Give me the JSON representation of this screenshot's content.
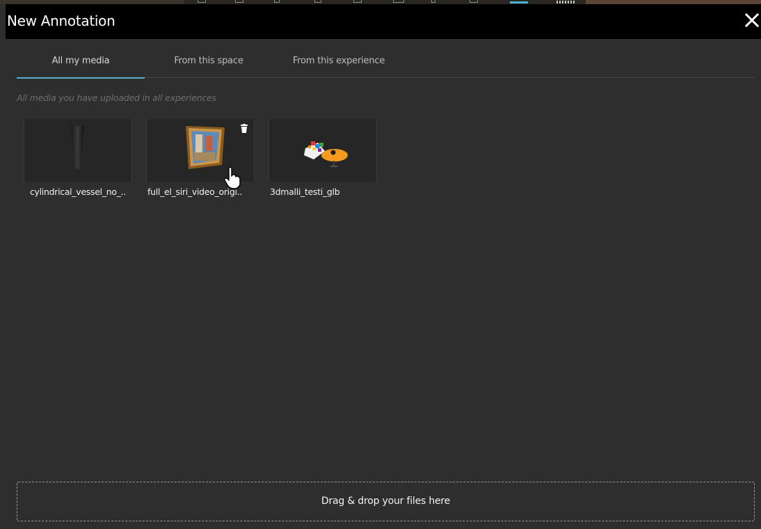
{
  "dialog": {
    "title": "New Annotation",
    "close_icon": "close-icon"
  },
  "tabs": [
    {
      "label": "All my media",
      "active": true
    },
    {
      "label": "From this space",
      "active": false
    },
    {
      "label": "From this experience",
      "active": false
    }
  ],
  "subtitle": "All media you have uploaded in all experiences",
  "media": [
    {
      "name": "cylindrical_vessel_no_..",
      "thumbnail": "dark-cylinder-model"
    },
    {
      "name": "full_el_siri_video_origi..",
      "thumbnail": "framed-painting-model",
      "hovered": true
    },
    {
      "name": "3dmalli_testi_glb",
      "thumbnail": "colorful-object-with-orange-disc"
    }
  ],
  "dropzone": {
    "label": "Drag & drop your files here"
  },
  "colors": {
    "accent": "#5aaecd",
    "background": "#2e2e2e",
    "header": "#000000"
  }
}
